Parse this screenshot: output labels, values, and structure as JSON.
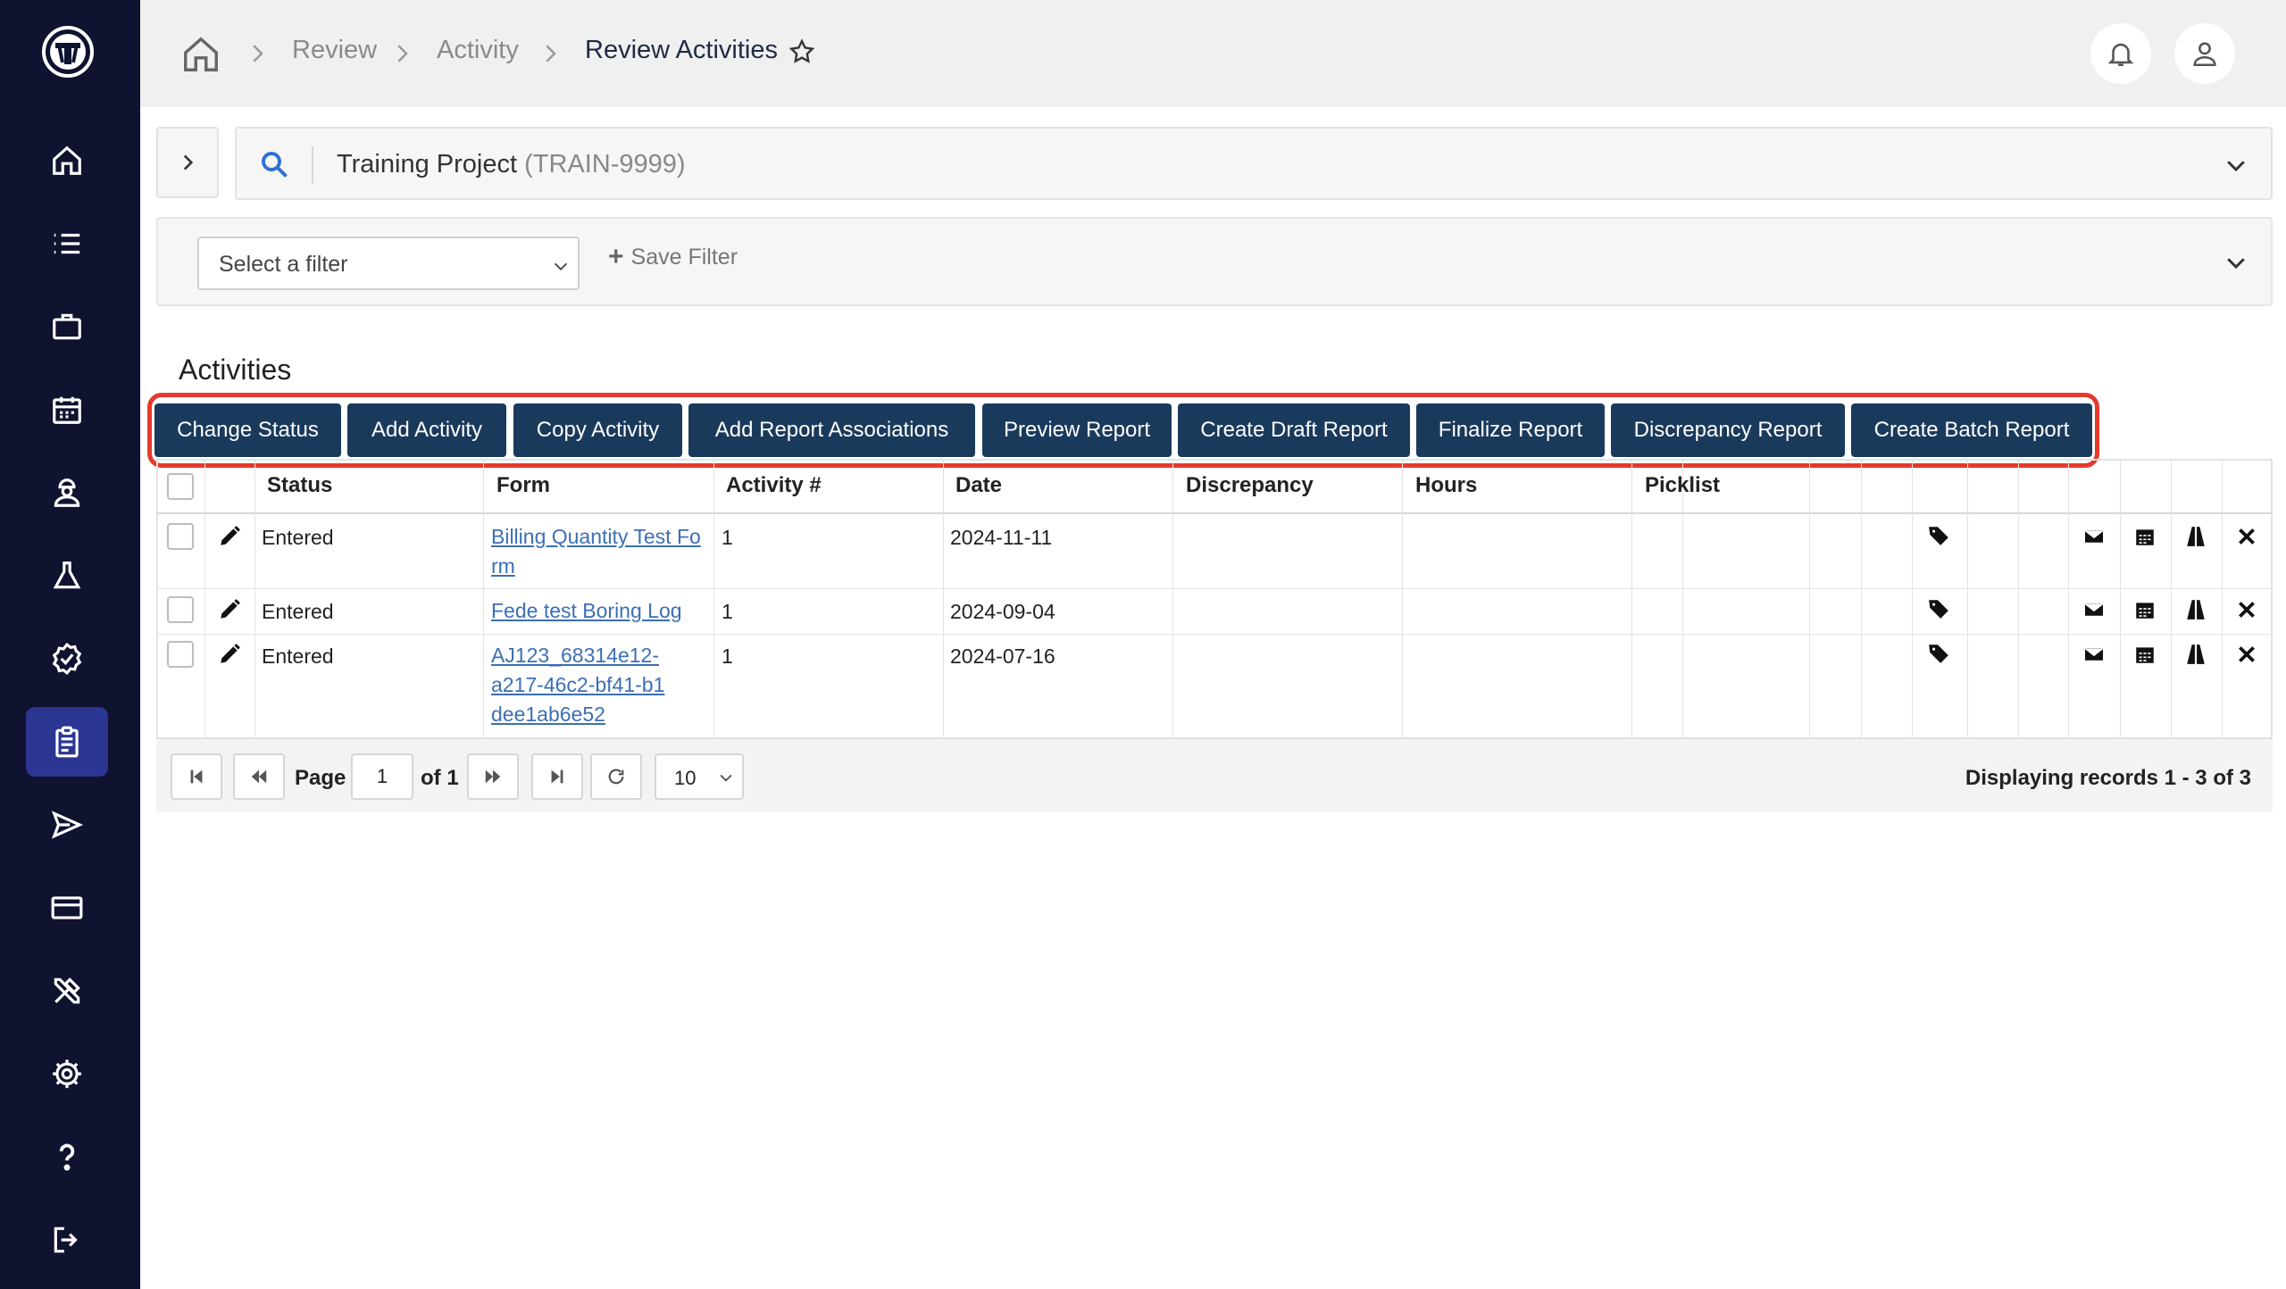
{
  "app": {
    "logo": "tread-logo",
    "accent": "#1a3a5c",
    "sidebar_bg": "#0f1330",
    "highlight": "#e53a2c"
  },
  "sidebar": {
    "items": [
      {
        "icon": "home-icon"
      },
      {
        "icon": "list-icon"
      },
      {
        "icon": "briefcase-icon"
      },
      {
        "icon": "calendar-icon"
      },
      {
        "icon": "worker-icon"
      },
      {
        "icon": "flask-icon"
      },
      {
        "icon": "badge-check-icon"
      },
      {
        "icon": "clipboard-icon",
        "active": true
      },
      {
        "icon": "send-icon"
      },
      {
        "icon": "credit-card-icon"
      },
      {
        "icon": "tools-icon"
      },
      {
        "icon": "gear-icon"
      },
      {
        "icon": "help-icon"
      },
      {
        "icon": "logout-icon"
      }
    ]
  },
  "breadcrumb": {
    "items": [
      "Review",
      "Activity"
    ],
    "current": "Review Activities"
  },
  "project": {
    "name": "Training Project",
    "code": "(TRAIN-9999)"
  },
  "filter": {
    "selected": "Select a filter",
    "save_label": "Save Filter"
  },
  "section": {
    "title": "Activities"
  },
  "toolbar": {
    "buttons": [
      "Change Status",
      "Add Activity",
      "Copy Activity",
      "Add Report Associations",
      "Preview Report",
      "Create Draft Report",
      "Finalize Report",
      "Discrepancy Report",
      "Create Batch Report"
    ]
  },
  "table": {
    "headers": [
      "Status",
      "Form",
      "Activity #",
      "Date",
      "Discrepancy",
      "Hours",
      "Picklist"
    ],
    "rows": [
      {
        "status": "Entered",
        "form": "Billing Quantity Test Form",
        "activity": "1",
        "date": "2024-11-11",
        "discrepancy": "",
        "hours": "",
        "picklist": ""
      },
      {
        "status": "Entered",
        "form": "Fede test Boring Log",
        "activity": "1",
        "date": "2024-09-04",
        "discrepancy": "",
        "hours": "",
        "picklist": ""
      },
      {
        "status": "Entered",
        "form": "AJ123_68314e12-a217-46c2-bf41-b1dee1ab6e52",
        "activity": "1",
        "date": "2024-07-16",
        "discrepancy": "",
        "hours": "",
        "picklist": ""
      }
    ]
  },
  "pager": {
    "page_label": "Page",
    "page": "1",
    "of_label": "of 1",
    "page_size": "10",
    "display": "Displaying records 1 - 3 of 3"
  }
}
